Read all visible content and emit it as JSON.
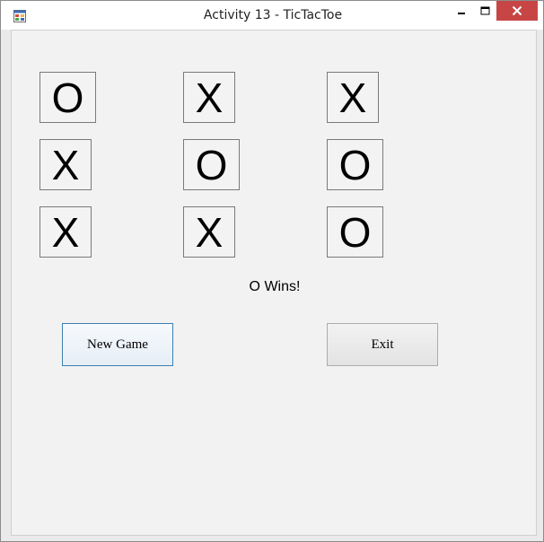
{
  "window": {
    "title": "Activity 13 - TicTacToe",
    "close_color": "#c74645",
    "icons": {
      "app": "app-window-icon",
      "minimize": "minimize-icon",
      "maximize": "maximize-icon",
      "close": "close-icon"
    }
  },
  "board": {
    "cells": [
      "O",
      "X",
      "X",
      "X",
      "O",
      "O",
      "X",
      "X",
      "O"
    ]
  },
  "status": "O Wins!",
  "buttons": {
    "new_game": "New Game",
    "exit": "Exit"
  }
}
